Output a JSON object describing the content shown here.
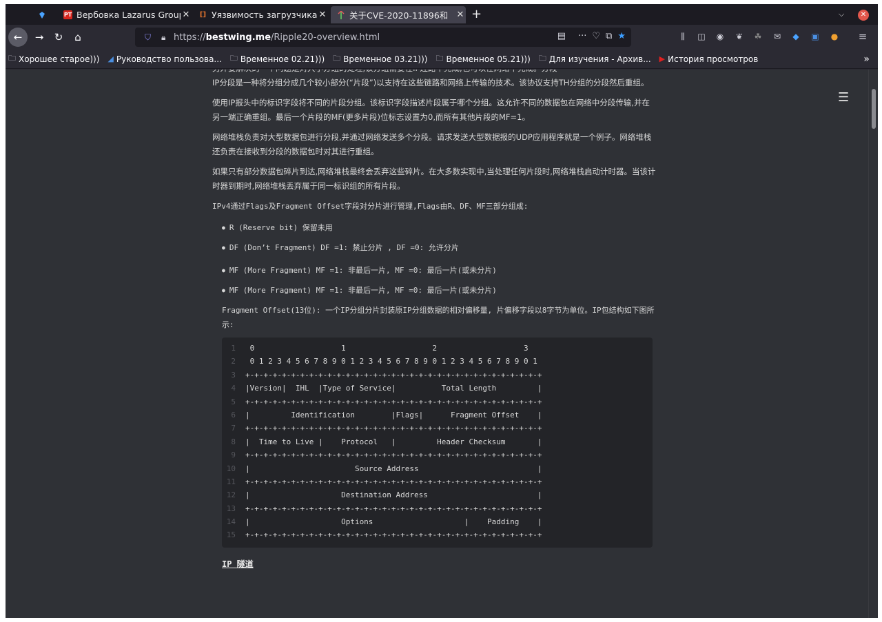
{
  "tabs": [
    {
      "title": "",
      "favicon": "diamond-icon",
      "favicon_color": "#4aa3ff"
    },
    {
      "title": "Вербовка Lazarus Group",
      "favicon": "pt-icon",
      "favicon_text": "PT",
      "favicon_color": "#d7261e",
      "close": "✕"
    },
    {
      "title": "Уязвимость загрузчика",
      "favicon": "bracket-icon",
      "favicon_text": "[]",
      "favicon_color": "#e8762e",
      "close": "✕"
    },
    {
      "title": "关于CVE-2020-11896和",
      "favicon": "page-icon",
      "favicon_color": "#5fb35f",
      "close": "✕",
      "active": true
    }
  ],
  "new_tab": "+",
  "nav": {
    "url_prefix": "https://",
    "url_domain": "bestwing.me",
    "url_path": "/Ripple20-overview.html"
  },
  "bookmarks": [
    {
      "label": "Хорошее старое)))",
      "icon": "folder-icon"
    },
    {
      "label": "Руководство пользова...",
      "icon": "page-icon"
    },
    {
      "label": "Временное 02.21)))",
      "icon": "folder-icon"
    },
    {
      "label": "Временное 03.21)))",
      "icon": "folder-icon"
    },
    {
      "label": "Временное 05.21)))",
      "icon": "folder-icon"
    },
    {
      "label": "Для изучения - Архив...",
      "icon": "folder-icon"
    },
    {
      "label": "История просмотров",
      "icon": "youtube-icon"
    }
  ],
  "article": {
    "partial_line": "另外要解决的一个问题是对大小分组的处理,该分组需要在IP连路中完成,也可以在网络中完成。分段",
    "p1": "IP分段是一种将分组分成几个较小部分(“片段”)以支持在这些链路和网络上传输的技术。该协议支持TH分组的分段然后重组。",
    "p2": "使用IP报头中的标识字段将不同的片段分组。该标识字段描述片段属于哪个分组。这允许不同的数据包在网络中分段传输,并在另一端正确重组。最后一个片段的MF(更多片段)位标志设置为0,而所有其他片段的MF=1。",
    "p3": "网络堆栈负责对大型数据包进行分段,并通过网络发送多个分段。请求发送大型数据报的UDP应用程序就是一个例子。网络堆栈还负责在接收到分段的数据包时对其进行重组。",
    "p4": "如果只有部分数据包碎片到达,网络堆栈最终会丢弃这些碎片。在大多数实现中,当处理任何片段时,网络堆栈启动计时器。当该计时器到期时,网络堆栈丢弃属于同一标识组的所有片段。",
    "p5": "IPv4通过Flags及Fragment Offset字段对分片进行管理,Flags由R、DF、MF三部分组成:",
    "bullets": [
      "R (Reserve bit) 保留未用",
      "DF (Don’t Fragment) DF =1: 禁止分片 , DF =0: 允许分片",
      "MF (More Fragment) MF =1: 非最后一片, MF =0: 最后一片(或未分片)",
      "MF (More Fragment) MF =1: 非最后一片, MF =0: 最后一片(或未分片)"
    ],
    "p6": "Fragment Offset(13位): 一个IP分组分片封装原IP分组数据的相对偏移量, 片偏移字段以8字节为单位。IP包结构如下图所示:",
    "code_lines": [
      {
        "n": "1",
        "t": " 0                   1                   2                   3"
      },
      {
        "n": "2",
        "t": " 0 1 2 3 4 5 6 7 8 9 0 1 2 3 4 5 6 7 8 9 0 1 2 3 4 5 6 7 8 9 0 1"
      },
      {
        "n": "3",
        "t": "+-+-+-+-+-+-+-+-+-+-+-+-+-+-+-+-+-+-+-+-+-+-+-+-+-+-+-+-+-+-+-+-+"
      },
      {
        "n": "4",
        "t": "|Version|  IHL  |Type of Service|          Total Length         |"
      },
      {
        "n": "5",
        "t": "+-+-+-+-+-+-+-+-+-+-+-+-+-+-+-+-+-+-+-+-+-+-+-+-+-+-+-+-+-+-+-+-+"
      },
      {
        "n": "6",
        "t": "|         Identification        |Flags|      Fragment Offset    |"
      },
      {
        "n": "7",
        "t": "+-+-+-+-+-+-+-+-+-+-+-+-+-+-+-+-+-+-+-+-+-+-+-+-+-+-+-+-+-+-+-+-+"
      },
      {
        "n": "8",
        "t": "|  Time to Live |    Protocol   |         Header Checksum       |"
      },
      {
        "n": "9",
        "t": "+-+-+-+-+-+-+-+-+-+-+-+-+-+-+-+-+-+-+-+-+-+-+-+-+-+-+-+-+-+-+-+-+"
      },
      {
        "n": "10",
        "t": "|                       Source Address                          |"
      },
      {
        "n": "11",
        "t": "+-+-+-+-+-+-+-+-+-+-+-+-+-+-+-+-+-+-+-+-+-+-+-+-+-+-+-+-+-+-+-+-+"
      },
      {
        "n": "12",
        "t": "|                    Destination Address                        |"
      },
      {
        "n": "13",
        "t": "+-+-+-+-+-+-+-+-+-+-+-+-+-+-+-+-+-+-+-+-+-+-+-+-+-+-+-+-+-+-+-+-+"
      },
      {
        "n": "14",
        "t": "|                    Options                    |    Padding    |"
      },
      {
        "n": "15",
        "t": "+-+-+-+-+-+-+-+-+-+-+-+-+-+-+-+-+-+-+-+-+-+-+-+-+-+-+-+-+-+-+-+-+"
      }
    ],
    "heading": "IP 隧道"
  },
  "colors": {
    "page_bg": "#2f3136",
    "code_bg": "#232428",
    "toolbar": "#2b2a33",
    "tabbar": "#1c1b22"
  }
}
